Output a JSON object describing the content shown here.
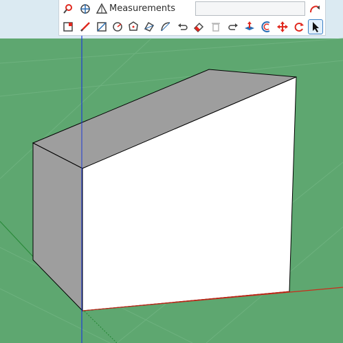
{
  "app": {
    "measurements_label": "Measurements",
    "measurements_value": "",
    "colors": {
      "sky": "#dbeaf2",
      "ground": "#5ea770",
      "ground_grid": "#6eb27f",
      "face_shaded": "#9e9e9e",
      "face_front": "#ffffff",
      "edge": "#000000",
      "axis_blue": "#1f3bd6",
      "axis_red": "#cc2a1a",
      "axis_green": "#2a8a3a",
      "tool_active_border": "#3a7fc6",
      "icon_red": "#e0281e",
      "icon_blue": "#2a6fb5"
    },
    "toolbar_row1": [
      {
        "name": "position-camera-icon"
      },
      {
        "name": "walk-look-icon"
      },
      {
        "name": "section-plane-icon"
      },
      {
        "name": "measurements-input"
      },
      {
        "name": "follow-me-icon"
      }
    ],
    "toolbar_row2": [
      {
        "name": "select-tool-icon",
        "active": true
      },
      {
        "name": "pencil-line-icon"
      },
      {
        "name": "rectangle-icon"
      },
      {
        "name": "circle-icon"
      },
      {
        "name": "polygon-icon"
      },
      {
        "name": "rotated-rectangle-icon"
      },
      {
        "name": "arc-icon"
      },
      {
        "name": "undo-icon"
      },
      {
        "name": "eraser-icon"
      },
      {
        "name": "delete-icon"
      },
      {
        "name": "redo-icon"
      },
      {
        "name": "push-pull-icon"
      },
      {
        "name": "offset-icon"
      },
      {
        "name": "move-icon"
      },
      {
        "name": "rotate-icon"
      },
      {
        "name": "select-arrow-icon"
      }
    ]
  }
}
